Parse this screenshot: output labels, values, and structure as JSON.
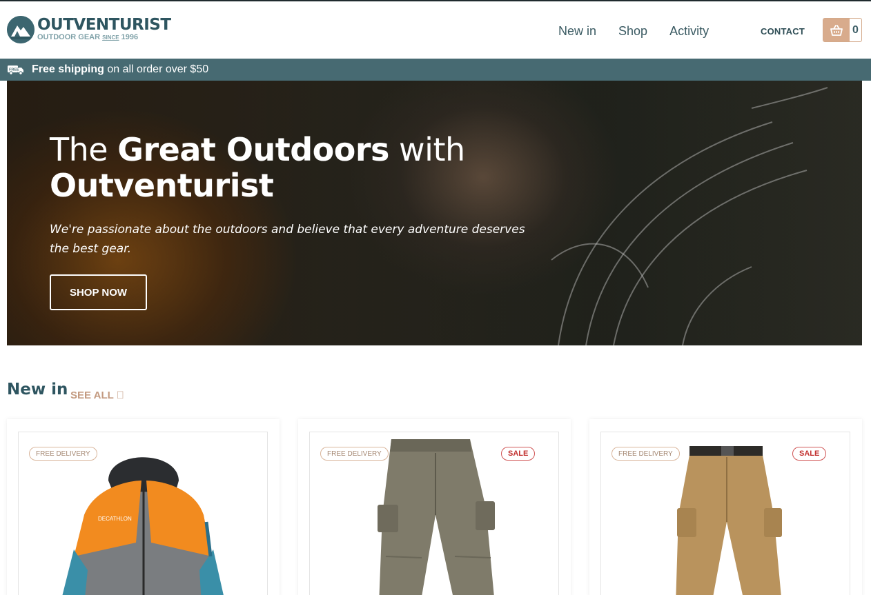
{
  "header": {
    "brand_name": "OUTVENTURIST",
    "brand_tag_prefix": "OUTDOOR GEAR",
    "brand_tag_since": "SINCE",
    "brand_tag_year": "1996",
    "nav": [
      "New in",
      "Shop",
      "Activity"
    ],
    "contact_label": "CONTACT",
    "cart_count": "0"
  },
  "shipping_bar": {
    "icon_text": "FREE",
    "bold_text": "Free shipping",
    "text": " on all order over $50"
  },
  "hero": {
    "title_part1": "The ",
    "title_part2": "Great Outdoors",
    "title_part3": " with",
    "title_part4": "Outventurist",
    "subtitle": "We're passionate about the outdoors and believe that every adventure deserves the best gear.",
    "button_label": "SHOP NOW"
  },
  "new_in": {
    "title": "New in",
    "see_all_label": "SEE ALL ⃞",
    "products": [
      {
        "free_badge": "FREE DELIVERY",
        "sale_badge": "",
        "art": "orange-rain-jacket"
      },
      {
        "free_badge": "FREE DELIVERY",
        "sale_badge": "SALE",
        "art": "grey-cargo-pants"
      },
      {
        "free_badge": "FREE DELIVERY",
        "sale_badge": "SALE",
        "art": "khaki-cargo-pants"
      }
    ]
  },
  "colors": {
    "brand": "#2e5560",
    "ship_bar": "#476a72",
    "cart_accent": "#d8ab8c",
    "sale_red": "#c2312f"
  }
}
